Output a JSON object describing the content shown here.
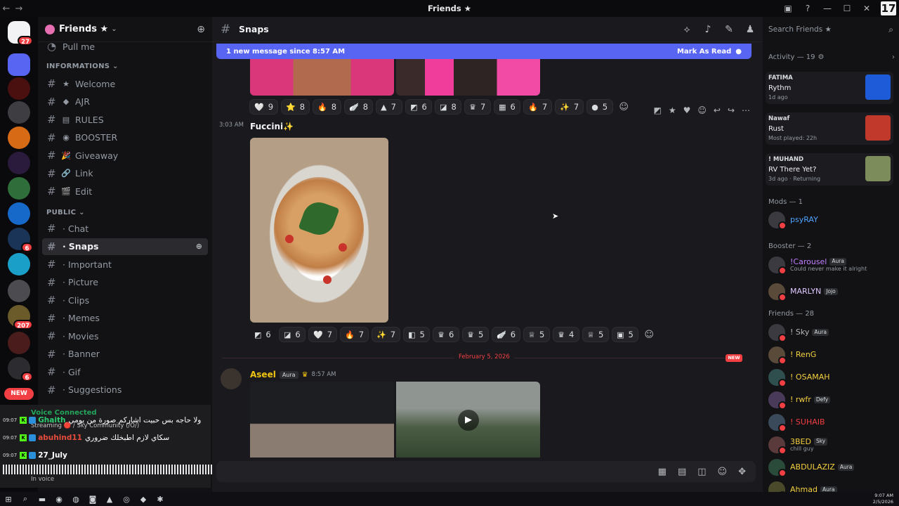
{
  "titlebar": {
    "title": "Friends ★",
    "logo": "17"
  },
  "server": {
    "name": "Friends ★"
  },
  "sidebar": {
    "partial_top": "Pull me",
    "cat_info": "INFORMATIONS",
    "info_channels": [
      {
        "emoji": "★",
        "name": "Welcome"
      },
      {
        "emoji": "◆",
        "name": "AJR"
      },
      {
        "emoji": "▤",
        "name": "RULES"
      },
      {
        "emoji": "◉",
        "name": "BOOSTER"
      },
      {
        "emoji": "🎉",
        "name": "Giveaway"
      },
      {
        "emoji": "🔗",
        "name": "Link"
      },
      {
        "emoji": "🎬",
        "name": "Edit"
      }
    ],
    "cat_public": "PUBLIC",
    "public_channels": [
      "Chat",
      "Snaps",
      "Important",
      "Picture",
      "Clips",
      "Memes",
      "Movies",
      "Banner",
      "Gif",
      "Suggestions"
    ],
    "active_channel": "Snaps"
  },
  "guild_badges": {
    "home": "27",
    "g8": "6",
    "g11": "207",
    "g13": "6"
  },
  "new_pill": "NEW",
  "voice": {
    "header": "Voice Connected",
    "streaming": "Streaming 🔴 / Sky Community (/O/)",
    "in_voice": "In voice"
  },
  "stream_chat": [
    {
      "time": "09:07",
      "user": "Ghaith",
      "text": "ولا حاجه بس حبيت اشاركم صورة من يومي"
    },
    {
      "time": "09:07",
      "user": "abuhind11",
      "text": "سكاي لازم اطبخلك ضروري"
    },
    {
      "time": "09:07",
      "user": "27_July",
      "text": ""
    }
  ],
  "channel": {
    "name": "Snaps"
  },
  "banner": {
    "text": "1 new message since 8:57 AM",
    "action": "Mark As Read"
  },
  "reactions_top": [
    {
      "e": "🤍",
      "n": "9"
    },
    {
      "e": "⭐",
      "n": "8"
    },
    {
      "e": "🔥",
      "n": "8"
    },
    {
      "e": "🪽",
      "n": "8"
    },
    {
      "e": "▲",
      "n": "7"
    },
    {
      "e": "◩",
      "n": "6"
    },
    {
      "e": "◪",
      "n": "8"
    },
    {
      "e": "♛",
      "n": "7"
    },
    {
      "e": "▦",
      "n": "6"
    },
    {
      "e": "🔥",
      "n": "7"
    },
    {
      "e": "✨",
      "n": "7"
    },
    {
      "e": "●",
      "n": "5"
    }
  ],
  "message_fuccini": {
    "time": "3:03 AM",
    "text": "Fuccini✨"
  },
  "reactions_food": [
    {
      "e": "◩",
      "n": "6"
    },
    {
      "e": "◪",
      "n": "6"
    },
    {
      "e": "🤍",
      "n": "7"
    },
    {
      "e": "🔥",
      "n": "7"
    },
    {
      "e": "✨",
      "n": "7"
    },
    {
      "e": "◧",
      "n": "5"
    },
    {
      "e": "♛",
      "n": "6"
    },
    {
      "e": "♛",
      "n": "5"
    },
    {
      "e": "🪽",
      "n": "6"
    },
    {
      "e": "♕",
      "n": "5"
    },
    {
      "e": "♛",
      "n": "4"
    },
    {
      "e": "♕",
      "n": "5"
    },
    {
      "e": "▣",
      "n": "5"
    }
  ],
  "divider": {
    "date": "February 5, 2026",
    "new": "NEW"
  },
  "message_aseel": {
    "author": "Aseel",
    "tag": "Aura",
    "time": "8:57 AM"
  },
  "members": {
    "search_placeholder": "Search Friends ★",
    "activity_header": "Activity — 19",
    "activities": [
      {
        "user": "FATIMA",
        "game": "Rythm",
        "meta": "1d ago",
        "color": "#1e5bd8"
      },
      {
        "user": "Nawaf",
        "game": "Rust",
        "meta": "Most played: 22h",
        "color": "#c0392b"
      },
      {
        "user": "! MUHAND",
        "game": "RV There Yet?",
        "meta": "3d ago · Returning",
        "color": "#7c8c5a"
      }
    ],
    "groups": [
      {
        "label": "Mods — 1"
      },
      {
        "label": "Booster — 2"
      },
      {
        "label": "Friends — 28"
      }
    ],
    "mods": [
      {
        "name": "psyRAY",
        "color": "#4fa3ff"
      }
    ],
    "boosters": [
      {
        "name": "!Carousel",
        "tag": "Aura",
        "sub": "Could never make it alright",
        "color": "#c080ff"
      },
      {
        "name": "MARLYN",
        "tag": "Jojo",
        "sub": "",
        "color": "#e0c8ff"
      }
    ],
    "friends": [
      {
        "name": "! Sky",
        "tag": "Aura",
        "sub": "",
        "color": "#b5b8bd"
      },
      {
        "name": "! RenG",
        "tag": "",
        "sub": "",
        "color": "#f4d03f"
      },
      {
        "name": "! OSAMAH",
        "tag": "",
        "sub": "",
        "color": "#f4d03f"
      },
      {
        "name": "! rwfr",
        "tag": "Defy",
        "sub": "",
        "color": "#f4d03f"
      },
      {
        "name": "! SUHAIB",
        "tag": "",
        "sub": "",
        "color": "#f23f43"
      },
      {
        "name": "3BED",
        "tag": "Sky",
        "sub": "chill guy",
        "color": "#f4d03f"
      },
      {
        "name": "ABDULAZIZ",
        "tag": "Aura",
        "sub": "",
        "color": "#f4d03f"
      },
      {
        "name": "Ahmad",
        "tag": "Aura",
        "sub": "",
        "color": "#f4d03f"
      }
    ]
  },
  "taskbar": {
    "time": "9:07 AM",
    "date": "2/5/2026"
  }
}
